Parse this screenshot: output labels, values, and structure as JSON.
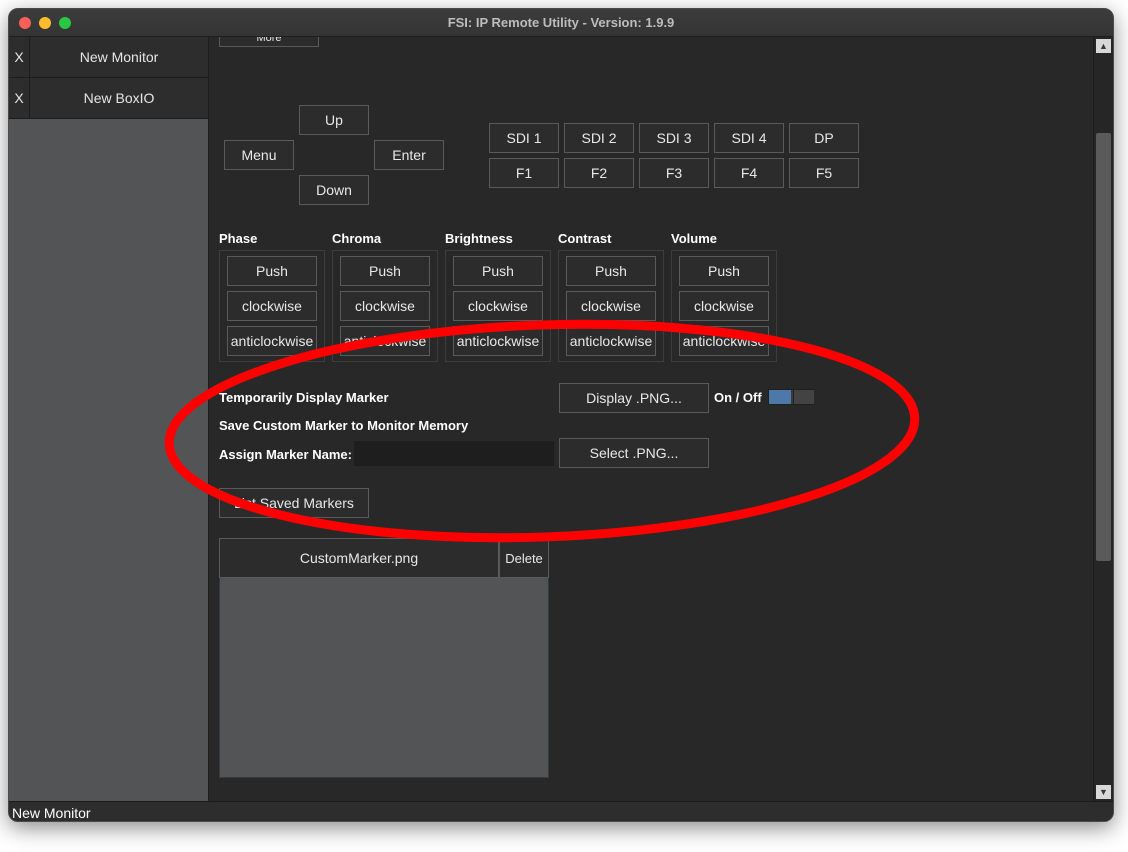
{
  "window": {
    "title": "FSI: IP Remote Utility - Version: 1.9.9"
  },
  "sidebar": {
    "tabs": [
      {
        "close": "X",
        "label": "New Monitor"
      },
      {
        "close": "X",
        "label": "New BoxIO"
      }
    ]
  },
  "nav": {
    "partial_label": "More",
    "up": "Up",
    "down": "Down",
    "menu": "Menu",
    "enter": "Enter"
  },
  "inputs": {
    "row1": [
      "SDI 1",
      "SDI 2",
      "SDI 3",
      "SDI 4",
      "DP"
    ],
    "row2": [
      "F1",
      "F2",
      "F3",
      "F4",
      "F5"
    ]
  },
  "knobs": [
    {
      "title": "Phase",
      "push": "Push",
      "cw": "clockwise",
      "acw": "anticlockwise"
    },
    {
      "title": "Chroma",
      "push": "Push",
      "cw": "clockwise",
      "acw": "anticlockwise"
    },
    {
      "title": "Brightness",
      "push": "Push",
      "cw": "clockwise",
      "acw": "anticlockwise"
    },
    {
      "title": "Contrast",
      "push": "Push",
      "cw": "clockwise",
      "acw": "anticlockwise"
    },
    {
      "title": "Volume",
      "push": "Push",
      "cw": "clockwise",
      "acw": "anticlockwise"
    }
  ],
  "markers": {
    "temp_label": "Temporarily Display Marker",
    "display_button": "Display .PNG...",
    "onoff_label": "On / Off",
    "toggle_state": "on",
    "save_label": "Save Custom Marker to Monitor Memory",
    "assign_label": "Assign Marker Name:",
    "assign_value": "",
    "select_button": "Select .PNG...",
    "list_button": "List Saved Markers",
    "table_file": "CustomMarker.png",
    "table_delete": "Delete"
  },
  "statusbar": {
    "text": "New Monitor"
  },
  "colors": {
    "annotation": "#ff0000",
    "toggle_accent": "#4e78a8"
  }
}
